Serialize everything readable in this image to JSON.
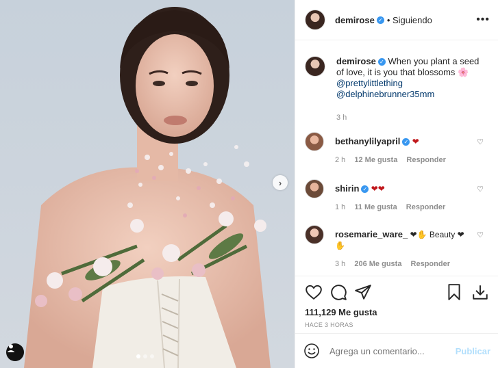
{
  "post": {
    "username": "demirose",
    "follow_status": "Siguiendo",
    "more_label": "•••",
    "caption_text": "When you plant a seed of love, it is you that blossoms 🌸",
    "mentions": [
      "@prettylittlething",
      "@delphinebrunner35mm"
    ],
    "caption_time": "3 h",
    "likes": "111,129 Me gusta",
    "posted_ago": "HACE 3 HORAS"
  },
  "comments": [
    {
      "user": "bethanylilyapril",
      "text": "❤",
      "time": "2 h",
      "likes": "12 Me gusta",
      "reply": "Responder"
    },
    {
      "user": "shirin",
      "text": "❤❤",
      "time": "1 h",
      "likes": "11 Me gusta",
      "reply": "Responder"
    },
    {
      "user": "rosemarie_ware_",
      "text": "❤✋ Beauty ❤ ✋",
      "time": "3 h",
      "likes": "206 Me gusta",
      "reply": "Responder"
    }
  ],
  "composer": {
    "placeholder": "Agrega un comentario...",
    "publish": "Publicar"
  },
  "colors": {
    "link": "#00376b",
    "verified": "#3897f0",
    "heart": "#c0171b",
    "publish_disabled": "#b2dffc"
  },
  "icons": [
    "heart-icon",
    "comment-icon",
    "share-icon",
    "bookmark-icon",
    "download-icon",
    "emoji-icon",
    "user-tag-icon",
    "chevron-right-icon",
    "verified-icon",
    "more-icon"
  ],
  "carousel": {
    "total": 3,
    "current": 1
  }
}
